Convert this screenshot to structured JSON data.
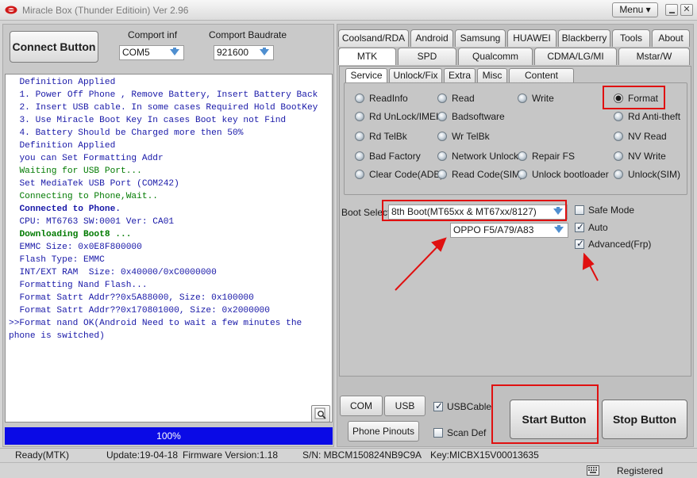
{
  "window": {
    "title": "Miracle Box (Thunder Editioin) Ver 2.96",
    "menu_label": "Menu ▾",
    "close_glyph": "✕"
  },
  "left": {
    "connect_label": "Connect Button",
    "comport_label": "Comport inf",
    "comport_value": "COM5",
    "baud_label": "Comport Baudrate",
    "baud_value": "921600",
    "progress_text": "100%",
    "progress_fraction": 1.0
  },
  "log": [
    {
      "text": "  Definition Applied",
      "color": "blue"
    },
    {
      "text": "  1. Power Off Phone , Remove Battery, Insert Battery Back",
      "color": "blue"
    },
    {
      "text": "  2. Insert USB cable. In some cases Required Hold BootKey",
      "color": "blue"
    },
    {
      "text": "  3. Use Miracle Boot Key In cases Boot key not Find",
      "color": "blue"
    },
    {
      "text": "  4. Battery Should be Charged more then 50%",
      "color": "blue"
    },
    {
      "text": "  Definition Applied",
      "color": "blue"
    },
    {
      "text": "  you can Set Formatting Addr",
      "color": "blue"
    },
    {
      "text": "  Waiting for USB Port...",
      "color": "green"
    },
    {
      "text": "  Set MediaTek USB Port (COM242)",
      "color": "blue"
    },
    {
      "text": "  Connecting to Phone,Wait..",
      "color": "green"
    },
    {
      "text": "  Connected to Phone.",
      "color": "blue",
      "bold": true
    },
    {
      "text": "  CPU: MT6763 SW:0001 Ver: CA01",
      "color": "blue"
    },
    {
      "text": "  Downloading Boot8 ...",
      "color": "green",
      "bold": true
    },
    {
      "text": "  EMMC Size: 0x0E8F800000",
      "color": "blue"
    },
    {
      "text": "  Flash Type: EMMC",
      "color": "blue"
    },
    {
      "text": "  INT/EXT RAM  Size: 0x40000/0xC0000000",
      "color": "blue"
    },
    {
      "text": "  Formatting Nand Flash...",
      "color": "blue"
    },
    {
      "text": "  Format Satrt Addr??0x5A88000, Size: 0x100000",
      "color": "blue"
    },
    {
      "text": "  Format Satrt Addr??0x170801000, Size: 0x2000000",
      "color": "blue"
    },
    {
      "text": ">>Format nand OK(Android Need to wait a few minutes the phone is switched)",
      "color": "blue"
    }
  ],
  "tabs_row1": [
    "Coolsand/RDA",
    "Android",
    "Samsung",
    "HUAWEI",
    "Blackberry",
    "Tools",
    "About"
  ],
  "tabs_row2": [
    "MTK",
    "SPD",
    "Qualcomm",
    "CDMA/LG/MI",
    "Mstar/W"
  ],
  "subtabs": [
    "Service",
    "Unlock/Fix",
    "Extra",
    "Misc",
    "Content Setting"
  ],
  "options": {
    "readinfo": "ReadInfo",
    "read": "Read",
    "write": "Write",
    "format": "Format",
    "rd_unlock_imei": "Rd UnLock/IMEI",
    "badsoftware": "Badsoftware",
    "rd_anti_theft": "Rd Anti-theft",
    "rd_telbk": "Rd TelBk",
    "wr_telbk": "Wr TelBk",
    "nv_read": "NV Read",
    "bad_factory": "Bad Factory",
    "network_unlock": "Network Unlock",
    "repair_fs": "Repair FS",
    "nv_write": "NV Write",
    "clear_code_adb": "Clear Code(ADB)",
    "read_code_sim": "Read Code(SIM)",
    "unlock_bootloader": "Unlock bootloader",
    "unlock_sim": "Unlock(SIM)"
  },
  "boot": {
    "label": "Boot Select",
    "boot_value": "8th Boot(MT65xx & MT67xx/8127)",
    "model_value": "OPPO F5/A79/A83",
    "safe_mode": "Safe Mode",
    "auto": "Auto",
    "advanced": "Advanced(Frp)"
  },
  "bottom": {
    "com_scan": "COM Scan",
    "usb_scan": "USB Scan",
    "usb_cable": "USBCable",
    "phone_pinouts": "Phone Pinouts",
    "scan_def": "Scan Def",
    "start": "Start Button",
    "stop": "Stop Button"
  },
  "status": {
    "ready": "Ready(MTK)",
    "update": "Update:19-04-18",
    "firmware": "Firmware Version:1.18",
    "sn": "S/N: MBCM150824NB9C9A",
    "key": "Key:MICBX15V00013635",
    "registered": "Registered"
  },
  "colors": {
    "progress": "#0a0ae6",
    "highlight": "#e01010",
    "log_blue": "#1818a8",
    "log_green": "#007a00"
  }
}
